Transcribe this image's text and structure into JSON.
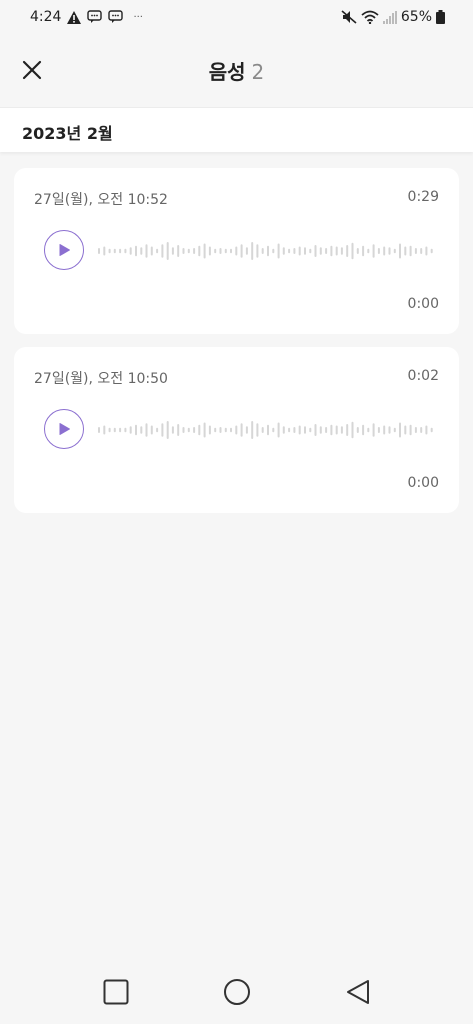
{
  "status_bar": {
    "time": "4:24",
    "dots": "···",
    "battery": "65%"
  },
  "header": {
    "title": "음성",
    "count": "2"
  },
  "month_label": "2023년 2월",
  "recordings": [
    {
      "date": "27일(월), 오전 10:52",
      "duration": "0:29",
      "elapsed": "0:00",
      "progress": 0
    },
    {
      "date": "27일(월), 오전 10:50",
      "duration": "0:02",
      "elapsed": "0:00",
      "progress": 0
    }
  ],
  "colors": {
    "accent": "#8b6fd0",
    "waveform": "#d6d6d6",
    "background": "#f6f6f6",
    "card": "#ffffff"
  },
  "icons": {
    "close": "close-icon",
    "play": "play-icon",
    "nav_recents": "square-icon",
    "nav_home": "circle-icon",
    "nav_back": "triangle-back-icon"
  }
}
